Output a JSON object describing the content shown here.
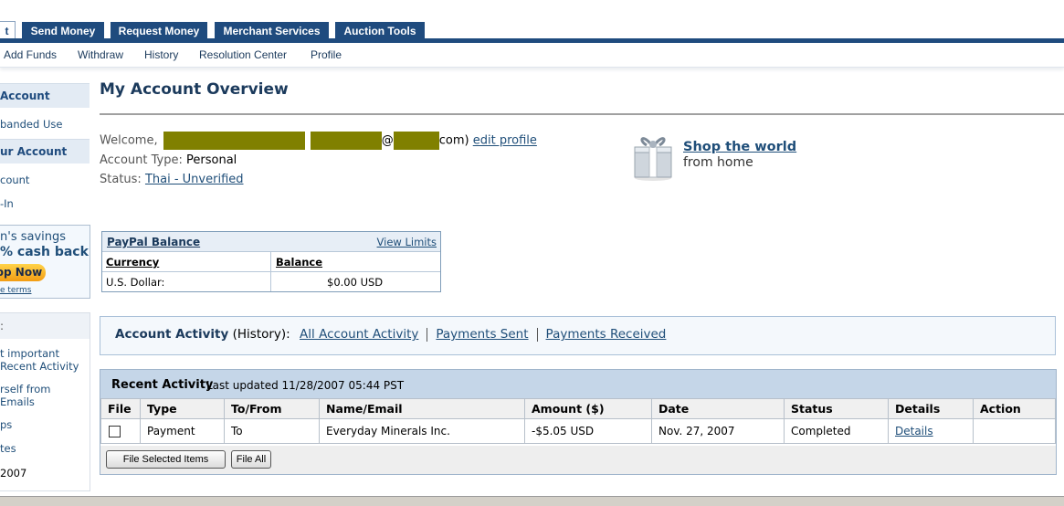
{
  "tabs": [
    {
      "label": "t",
      "active": true
    },
    {
      "label": "Send Money"
    },
    {
      "label": "Request Money"
    },
    {
      "label": "Merchant Services"
    },
    {
      "label": "Auction Tools"
    }
  ],
  "subnav": [
    "Add Funds",
    "Withdraw",
    "History",
    "Resolution Center",
    "Profile"
  ],
  "sidebar": {
    "heading1": "Account",
    "link1": "banded Use",
    "heading2": "ur Account",
    "link2": "count",
    "link3": "-In",
    "ad": {
      "line1": "n's savings",
      "line2": "% cash back",
      "button": "op Now",
      "terms": "e terms"
    },
    "box": {
      "title": ":",
      "line1": "t important",
      "line2": "Recent Activity",
      "line3": "rself from",
      "line4": "Emails",
      "line5": "ps",
      "line6": "tes",
      "line7": "2007"
    }
  },
  "page_title": "My Account Overview",
  "account": {
    "welcome_label": "Welcome,",
    "email_at": "@",
    "email_tail": "com)",
    "edit_profile": "edit profile",
    "type_label": "Account Type:",
    "type_value": "Personal",
    "status_label": "Status:",
    "status_value": "Thai - Unverified"
  },
  "promo": {
    "title": "Shop the world",
    "subtitle": "from home",
    "icon": "gift-icon"
  },
  "balance": {
    "title": "PayPal Balance",
    "view_limits": "View Limits",
    "col_currency": "Currency",
    "col_balance": "Balance",
    "currency": "U.S. Dollar:",
    "amount": "$0.00 USD"
  },
  "activity": {
    "label": "Account Activity",
    "history": "(History):",
    "links": [
      "All Account Activity",
      "Payments Sent",
      "Payments Received"
    ]
  },
  "recent": {
    "title": "Recent Activity",
    "updated": "Last updated 11/28/2007 05:44 PST",
    "columns": [
      "File",
      "Type",
      "To/From",
      "Name/Email",
      "Amount ($)",
      "Date",
      "Status",
      "Details",
      "Action"
    ],
    "rows": [
      {
        "type": "Payment",
        "to_from": "To",
        "name": "Everyday Minerals Inc.",
        "amount": "-$5.05 USD",
        "date": "Nov. 27, 2007",
        "status": "Completed",
        "details": "Details",
        "action": ""
      }
    ],
    "btn_file_selected": "File Selected Items",
    "btn_file_all": "File All"
  },
  "colors": {
    "nav": "#1f4b7e",
    "link": "#1f4e79",
    "redaction": "#808000",
    "header_bg": "#c5d6e8"
  }
}
